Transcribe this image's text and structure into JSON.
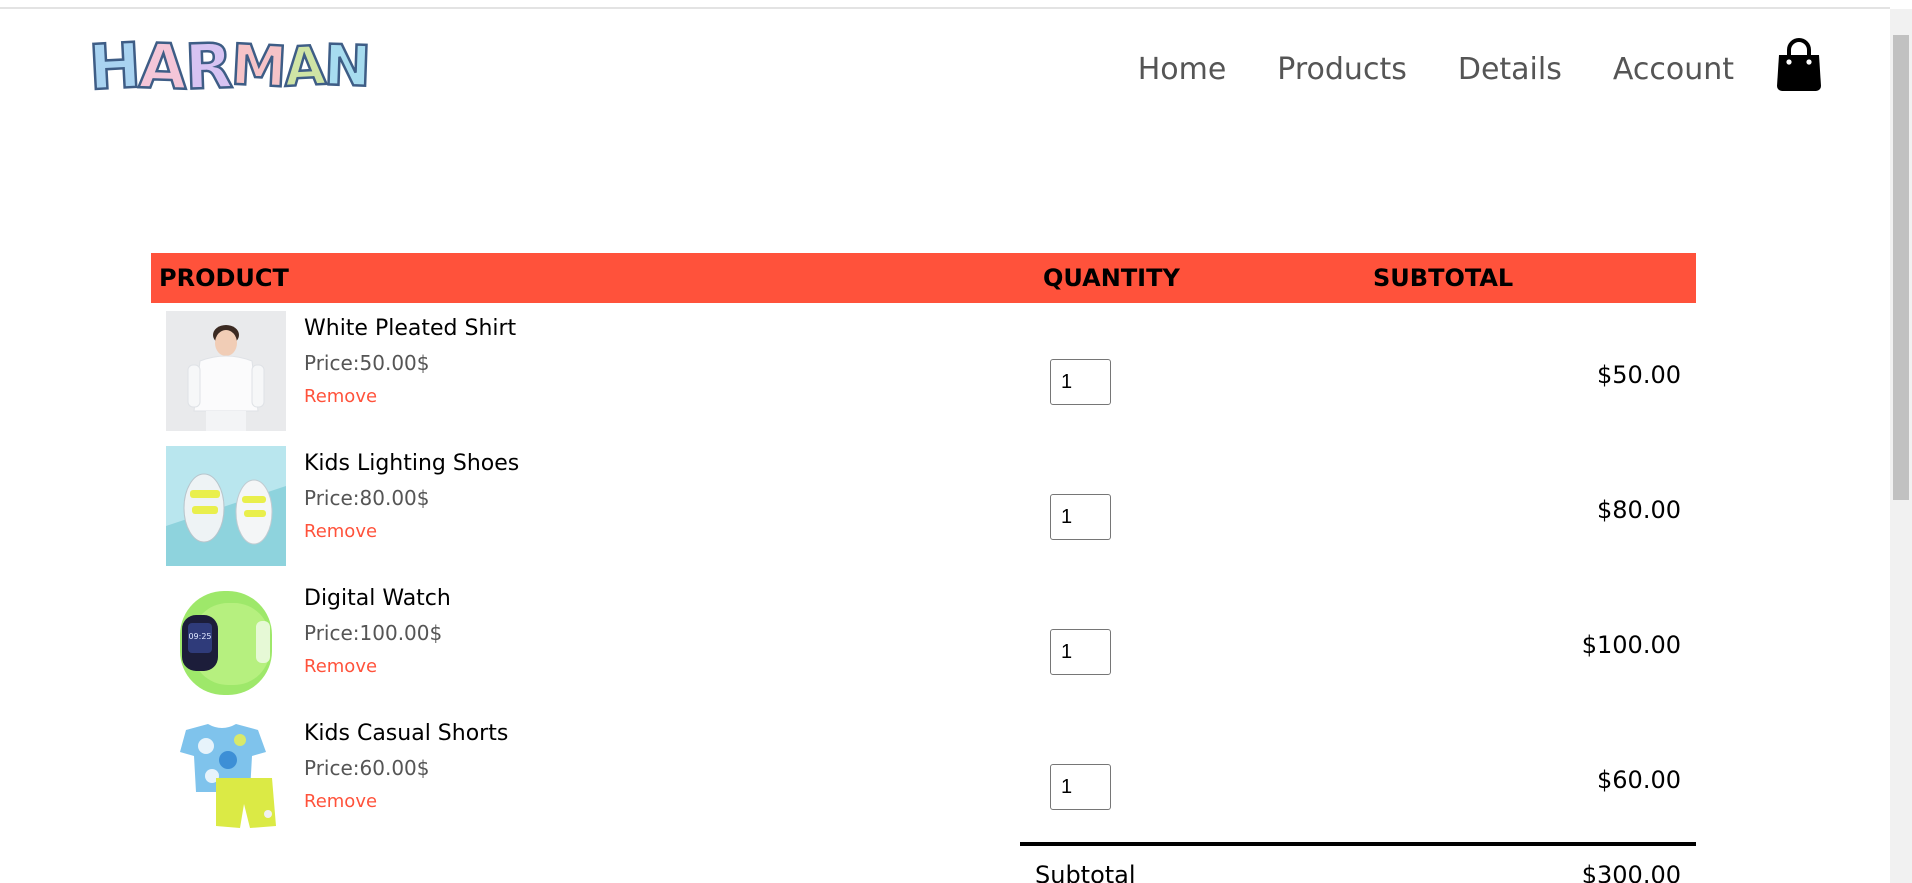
{
  "brand": {
    "logo_text": "HARMAN"
  },
  "nav": {
    "items": [
      {
        "label": "Home"
      },
      {
        "label": "Products"
      },
      {
        "label": "Details"
      },
      {
        "label": "Account"
      }
    ]
  },
  "cart": {
    "headers": {
      "product": "PRODUCT",
      "quantity": "QUANTITY",
      "subtotal": "SUBTOTAL"
    },
    "items": [
      {
        "name": "White Pleated Shirt",
        "price": "Price:50.00$",
        "remove": "Remove",
        "quantity": "1",
        "subtotal": "$50.00"
      },
      {
        "name": "Kids Lighting Shoes",
        "price": "Price:80.00$",
        "remove": "Remove",
        "quantity": "1",
        "subtotal": "$80.00"
      },
      {
        "name": "Digital Watch",
        "price": "Price:100.00$",
        "remove": "Remove",
        "quantity": "1",
        "subtotal": "$100.00"
      },
      {
        "name": "Kids Casual Shorts",
        "price": "Price:60.00$",
        "remove": "Remove",
        "quantity": "1",
        "subtotal": "$60.00"
      }
    ],
    "totals": {
      "subtotal_label": "Subtotal",
      "subtotal_value": "$300.00"
    }
  },
  "colors": {
    "accent": "#ff523b",
    "nav_text": "#555555"
  },
  "icons": {
    "cart": "shopping-bag-icon"
  }
}
